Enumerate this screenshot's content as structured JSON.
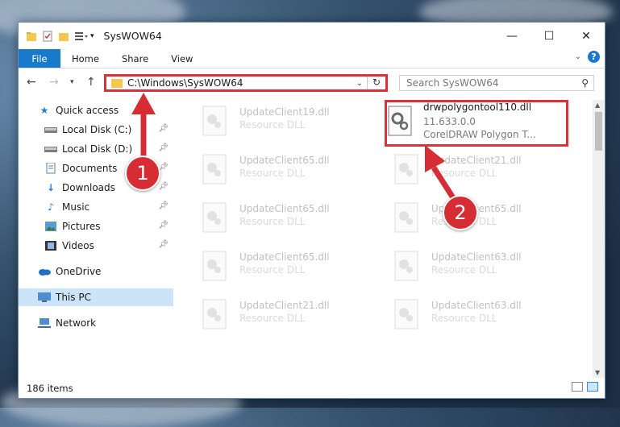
{
  "window": {
    "title": "SysWOW64",
    "minimize_glyph": "—",
    "maximize_glyph": "☐",
    "close_glyph": "✕"
  },
  "ribbon": {
    "file": "File",
    "tabs": [
      "Home",
      "Share",
      "View"
    ],
    "help": "?"
  },
  "address": {
    "path": "C:\\Windows\\SysWOW64"
  },
  "search": {
    "placeholder": "Search SysWOW64"
  },
  "sidebar": {
    "items": [
      {
        "label": "Quick access",
        "icon": "star-icon"
      },
      {
        "label": "Local Disk (C:)",
        "icon": "drive-icon"
      },
      {
        "label": "Local Disk (D:)",
        "icon": "drive-icon"
      },
      {
        "label": "Documents",
        "icon": "documents-icon"
      },
      {
        "label": "Downloads",
        "icon": "downloads-icon"
      },
      {
        "label": "Music",
        "icon": "music-icon"
      },
      {
        "label": "Pictures",
        "icon": "pictures-icon"
      },
      {
        "label": "Videos",
        "icon": "videos-icon"
      },
      {
        "label": "OneDrive",
        "icon": "cloud-icon"
      },
      {
        "label": "This PC",
        "icon": "pc-icon"
      },
      {
        "label": "Network",
        "icon": "network-icon"
      }
    ]
  },
  "files": [
    {
      "name": "UpdateClient19.dll",
      "sub": "Resource DLL"
    },
    {
      "name": "drwpolygontool110.dll",
      "version": "11.633.0.0",
      "desc": "CorelDRAW Polygon T..."
    },
    {
      "name": "UpdateClient65.dll",
      "sub": "Resource DLL"
    },
    {
      "name": "UpdateClient21.dll",
      "sub": "Resource DLL"
    },
    {
      "name": "UpdateClient65.dll",
      "sub": "Resource DLL"
    },
    {
      "name": "UpdateClient65.dll",
      "sub": "Resource DLL"
    },
    {
      "name": "UpdateClient65.dll",
      "sub": "Resource DLL"
    },
    {
      "name": "UpdateClient63.dll",
      "sub": "Resource DLL"
    },
    {
      "name": "UpdateClient21.dll",
      "sub": "Resource DLL"
    },
    {
      "name": "UpdateClient63.dll",
      "sub": "Resource DLL"
    }
  ],
  "status": {
    "count": "186 items"
  },
  "callouts": {
    "one": "1",
    "two": "2"
  },
  "colors": {
    "accent": "#1979ca",
    "highlight": "#d9323a"
  }
}
